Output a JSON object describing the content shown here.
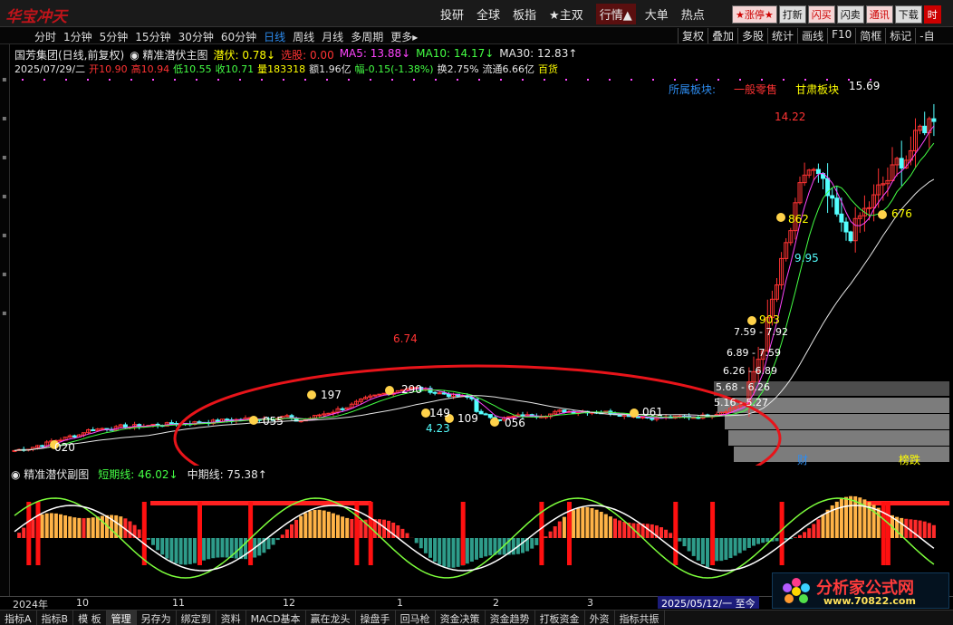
{
  "top": {
    "brand": "华宝冲天",
    "nav": [
      "投研",
      "全球",
      "板指",
      "★主双",
      "行情▲",
      "大单",
      "热点"
    ],
    "nav_active": 4,
    "right": [
      "★涨停★",
      "打新",
      "闪买",
      "闪卖",
      "通讯",
      "下载",
      "时"
    ]
  },
  "periods": [
    "分时",
    "1分钟",
    "5分钟",
    "15分钟",
    "30分钟",
    "60分钟",
    "日线",
    "周线",
    "月线",
    "多周期",
    "更多▸"
  ],
  "period_selected": 6,
  "tools": [
    "复权",
    "叠加",
    "多股",
    "统计",
    "画线",
    "F10",
    "简框",
    "标记",
    "-自"
  ],
  "info1": {
    "stock": "国芳集团(日线,前复权)",
    "indicator": "◉ 精准潜伏主图",
    "qianfu": "潜伏: 0.78↓",
    "xuangu": "选股: 0.00",
    "ma5": "MA5: 13.88↓",
    "ma10": "MA10: 14.17↓",
    "ma30": "MA30: 12.83↑"
  },
  "info2": {
    "date": "2025/07/29/二",
    "open": "开10.90",
    "high": "高10.94",
    "low": "低10.55",
    "close": "收10.71",
    "vol": "量183318",
    "amt": "额1.96亿",
    "chg": "幅-0.15(-1.38%)",
    "turn": "换2.75%",
    "float": "流通6.66亿",
    "sector": "百货"
  },
  "sector_row": [
    "所属板块:",
    "一般零售",
    "甘肃板块"
  ],
  "price_labels": [
    "15.69",
    "14.22",
    "6.74",
    "4.23",
    "9.95"
  ],
  "signals": [
    "020",
    "055",
    "197",
    "290",
    "149",
    "109",
    "056",
    "061",
    "903",
    "862",
    "676"
  ],
  "volume_boxes": [
    "5.16 - 5.27",
    "5.68 - 6.26",
    "6.26 - 6.89",
    "6.89 - 7.59",
    "7.59 - 7.92"
  ],
  "tag_cai": "财",
  "tag_bangdie": "榜跌",
  "sub": {
    "name": "◉ 精准潜伏副图",
    "short": "短期线: 46.02↓",
    "mid": "中期线: 75.38↑"
  },
  "time_axis": [
    "2024年",
    "10",
    "11",
    "12",
    "1",
    "2",
    "3"
  ],
  "date_range": "2025/05/12/一 至今",
  "bottom_tabs": [
    "指标A",
    "指标B",
    "模 板",
    "管理",
    "另存为",
    "绑定到",
    "资料",
    "MACD基本",
    "赢在龙头",
    "操盘手",
    "回马枪",
    "资金决策",
    "资金趋势",
    "打板资金",
    "外资",
    "指标共振"
  ],
  "bottom_active": 3,
  "watermark": {
    "title": "分析家公式网",
    "url": "www.70822.com"
  },
  "colors": {
    "up": "#ff3333",
    "down": "#54ffff",
    "ma5": "#ffffff",
    "ma10": "#ff44ff",
    "ma30": "#ffff00",
    "highlight": "#e8141a"
  }
}
